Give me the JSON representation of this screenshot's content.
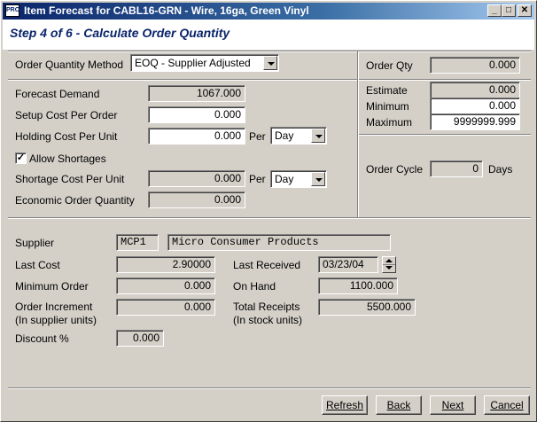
{
  "window": {
    "title": "Item Forecast for CABL16-GRN - Wire, 16ga, Green Vinyl",
    "app_icon": "PRO",
    "step_title": "Step 4 of 6 - Calculate Order Quantity"
  },
  "titlebar_buttons": {
    "minimize": "_",
    "maximize": "□",
    "close": "✕"
  },
  "order_method": {
    "label": "Order Quantity Method",
    "value": "EOQ - Supplier Adjusted"
  },
  "order_qty": {
    "label": "Order Qty",
    "value": "0.000"
  },
  "forecast": {
    "demand_label": "Forecast Demand",
    "demand_value": "1067.000",
    "setup_label": "Setup Cost Per Order",
    "setup_value": "0.000",
    "holding_label": "Holding Cost Per Unit",
    "holding_value": "0.000",
    "holding_per": "Per",
    "holding_period": "Day",
    "allow_shortages_label": "Allow Shortages",
    "allow_shortages_checked": true,
    "shortage_label": "Shortage Cost Per Unit",
    "shortage_value": "0.000",
    "shortage_per": "Per",
    "shortage_period": "Day",
    "eoq_label": "Economic Order Quantity",
    "eoq_value": "0.000"
  },
  "estimate": {
    "estimate_label": "Estimate",
    "estimate_value": "0.000",
    "minimum_label": "Minimum",
    "minimum_value": "0.000",
    "maximum_label": "Maximum",
    "maximum_value": "9999999.999"
  },
  "order_cycle": {
    "label": "Order Cycle",
    "value": "0",
    "unit": "Days"
  },
  "supplier": {
    "label": "Supplier",
    "code": "MCP1",
    "name": "Micro Consumer Products",
    "last_cost_label": "Last Cost",
    "last_cost_value": "2.90000",
    "min_order_label": "Minimum Order",
    "min_order_value": "0.000",
    "increment_label": "Order Increment",
    "increment_sublabel": "(In supplier units)",
    "increment_value": "0.000",
    "discount_label": "Discount %",
    "discount_value": "0.000",
    "last_received_label": "Last Received",
    "last_received_value": "03/23/04",
    "on_hand_label": "On Hand",
    "on_hand_value": "1100.000",
    "receipts_label": "Total Receipts",
    "receipts_sublabel": "(In stock units)",
    "receipts_value": "5500.000"
  },
  "buttons": {
    "refresh": "Refresh",
    "back": "Back",
    "next": "Next",
    "cancel": "Cancel"
  }
}
